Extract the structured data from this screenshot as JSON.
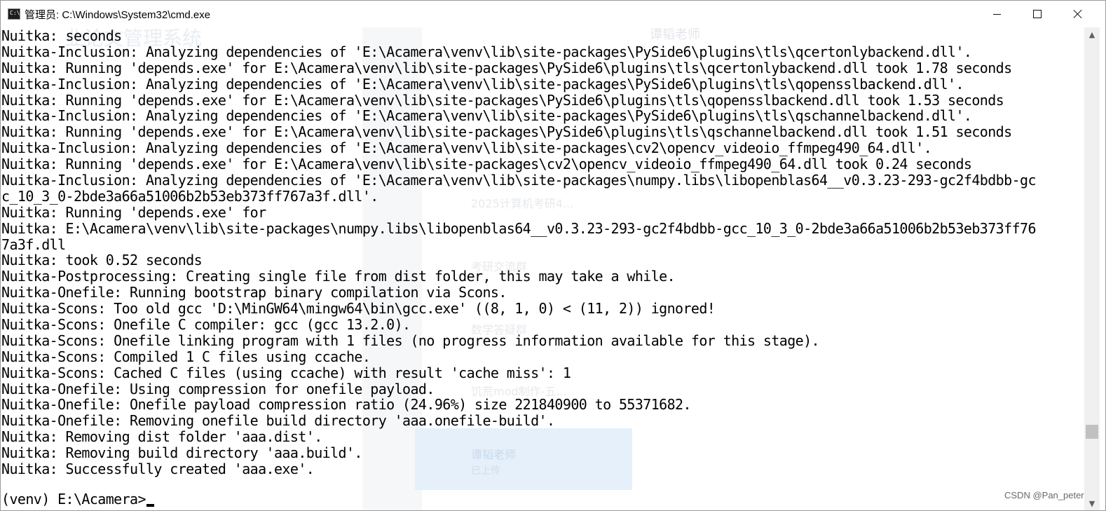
{
  "window": {
    "title": "管理员: C:\\Windows\\System32\\cmd.exe",
    "icon": "cmd-icon",
    "controls": [
      "minimize-icon",
      "maximize-icon",
      "close-icon"
    ]
  },
  "console": {
    "lines": [
      "Nuitka: seconds",
      "Nuitka-Inclusion: Analyzing dependencies of 'E:\\Acamera\\venv\\lib\\site-packages\\PySide6\\plugins\\tls\\qcertonlybackend.dll'.",
      "Nuitka: Running 'depends.exe' for E:\\Acamera\\venv\\lib\\site-packages\\PySide6\\plugins\\tls\\qcertonlybackend.dll took 1.78 seconds",
      "Nuitka-Inclusion: Analyzing dependencies of 'E:\\Acamera\\venv\\lib\\site-packages\\PySide6\\plugins\\tls\\qopensslbackend.dll'.",
      "Nuitka: Running 'depends.exe' for E:\\Acamera\\venv\\lib\\site-packages\\PySide6\\plugins\\tls\\qopensslbackend.dll took 1.53 seconds",
      "Nuitka-Inclusion: Analyzing dependencies of 'E:\\Acamera\\venv\\lib\\site-packages\\PySide6\\plugins\\tls\\qschannelbackend.dll'.",
      "Nuitka: Running 'depends.exe' for E:\\Acamera\\venv\\lib\\site-packages\\PySide6\\plugins\\tls\\qschannelbackend.dll took 1.51 seconds",
      "Nuitka-Inclusion: Analyzing dependencies of 'E:\\Acamera\\venv\\lib\\site-packages\\cv2\\opencv_videoio_ffmpeg490_64.dll'.",
      "Nuitka: Running 'depends.exe' for E:\\Acamera\\venv\\lib\\site-packages\\cv2\\opencv_videoio_ffmpeg490_64.dll took 0.24 seconds",
      "Nuitka-Inclusion: Analyzing dependencies of 'E:\\Acamera\\venv\\lib\\site-packages\\numpy.libs\\libopenblas64__v0.3.23-293-gc2f4bdbb-gc",
      "c_10_3_0-2bde3a66a51006b2b53eb373ff767a3f.dll'.",
      "Nuitka: Running 'depends.exe' for",
      "Nuitka: E:\\Acamera\\venv\\lib\\site-packages\\numpy.libs\\libopenblas64__v0.3.23-293-gc2f4bdbb-gcc_10_3_0-2bde3a66a51006b2b53eb373ff76",
      "7a3f.dll",
      "Nuitka: took 0.52 seconds",
      "Nuitka-Postprocessing: Creating single file from dist folder, this may take a while.",
      "Nuitka-Onefile: Running bootstrap binary compilation via Scons.",
      "Nuitka-Scons: Too old gcc 'D:\\MinGW64\\mingw64\\bin\\gcc.exe' ((8, 1, 0) < (11, 2)) ignored!",
      "Nuitka-Scons: Onefile C compiler: gcc (gcc 13.2.0).",
      "Nuitka-Scons: Onefile linking program with 1 files (no progress information available for this stage).",
      "Nuitka-Scons: Compiled 1 C files using ccache.",
      "Nuitka-Scons: Cached C files (using ccache) with result 'cache miss': 1",
      "Nuitka-Onefile: Using compression for onefile payload.",
      "Nuitka-Onefile: Onefile payload compression ratio (24.96%) size 221840900 to 55371682.",
      "Nuitka-Onefile: Removing onefile build directory 'aaa.onefile-build'.",
      "Nuitka: Removing dist folder 'aaa.dist'.",
      "Nuitka: Removing build directory 'aaa.build'.",
      "Nuitka: Successfully created 'aaa.exe'."
    ],
    "prompt": "(venv) E:\\Acamera>"
  },
  "background": {
    "ghost_title": "业论文管理系统",
    "ghost_contact": "谭韬老师",
    "ghost_chats": [
      "2025计算机考研4...",
      "考研交流群",
      "数学答疑群",
      "饥荒mod制作-五...",
      "谭韬老师"
    ],
    "ghost_card_text": "已上传"
  },
  "watermark": "CSDN @Pan_peter"
}
